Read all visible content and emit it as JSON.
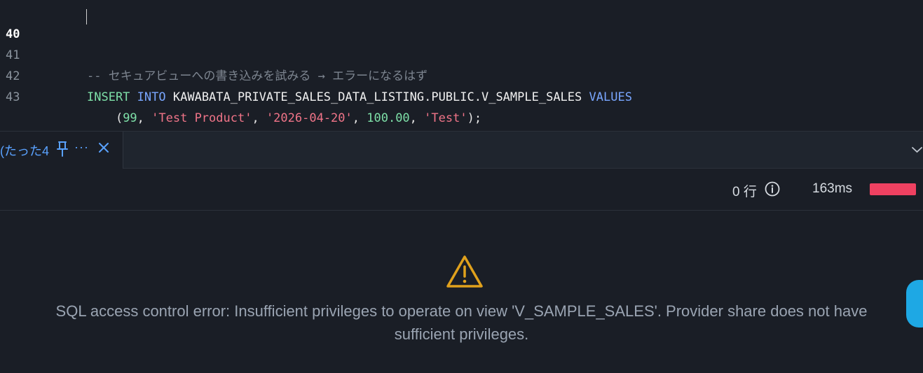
{
  "editor": {
    "lines": [
      {
        "number": "40",
        "active": true,
        "tokens": []
      },
      {
        "number": "41",
        "active": false,
        "tokens": [
          {
            "cls": "comment",
            "text": "-- セキュアビューへの書き込みを試みる → エラーになるはず"
          }
        ]
      },
      {
        "number": "42",
        "active": false,
        "tokens": [
          {
            "cls": "kw-green",
            "text": "INSERT"
          },
          {
            "cls": "punct",
            "text": " "
          },
          {
            "cls": "kw-blue",
            "text": "INTO"
          },
          {
            "cls": "punct",
            "text": " "
          },
          {
            "cls": "ident",
            "text": "KAWABATA_PRIVATE_SALES_DATA_LISTING.PUBLIC.V_SAMPLE_SALES"
          },
          {
            "cls": "punct",
            "text": " "
          },
          {
            "cls": "kw-blue",
            "text": "VALUES"
          }
        ]
      },
      {
        "number": "43",
        "active": false,
        "tokens": [
          {
            "cls": "punct",
            "text": "    ("
          },
          {
            "cls": "num",
            "text": "99"
          },
          {
            "cls": "punct",
            "text": ", "
          },
          {
            "cls": "str",
            "text": "'Test Product'"
          },
          {
            "cls": "punct",
            "text": ", "
          },
          {
            "cls": "str",
            "text": "'2026-04-20'"
          },
          {
            "cls": "punct",
            "text": ", "
          },
          {
            "cls": "num",
            "text": "100.00"
          },
          {
            "cls": "punct",
            "text": ", "
          },
          {
            "cls": "str",
            "text": "'Test'"
          },
          {
            "cls": "punct",
            "text": ");"
          }
        ]
      }
    ]
  },
  "result_tab": {
    "label": "(たった4",
    "more_label": "···"
  },
  "status": {
    "rows_label": "0 行",
    "duration_label": "163ms",
    "bar_color": "#ef4161"
  },
  "error": {
    "line1": "SQL access control error: Insufficient privileges to operate on view 'V_SAMPLE_SALES'. Provider share does not have",
    "line2": "sufficient privileges."
  },
  "icons": {
    "tab_pin": "pin-icon",
    "tab_close": "close-icon",
    "panel_toggle": "chevron-down-icon",
    "rows_info": "info-icon",
    "error": "warning-icon"
  },
  "colors": {
    "accent": "#5aa2ff",
    "warning": "#e0a11c",
    "error_bar": "#ef4161",
    "fab": "#1ea8e4"
  }
}
